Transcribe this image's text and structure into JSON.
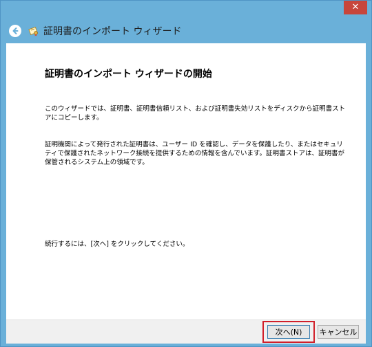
{
  "window": {
    "title": "証明書のインポート ウィザード",
    "close_glyph": "✕"
  },
  "main": {
    "heading": "証明書のインポート ウィザードの開始",
    "paragraph1": "このウィザードでは、証明書、証明書信頼リスト、および証明書失効リストをディスクから証明書ストアにコピーします。",
    "paragraph2": "証明機関によって発行された証明書は、ユーザー ID を確認し、データを保護したり、またはセキュリティで保護されたネットワーク接続を提供するための情報を含んでいます。証明書ストアは、証明書が保管されるシステム上の領域です。",
    "paragraph3": "続行するには、[次へ] をクリックしてください。"
  },
  "footer": {
    "next_label": "次へ(N)",
    "cancel_label": "キャンセル"
  },
  "colors": {
    "titlebar": "#6ab0d9",
    "close": "#c7463c",
    "highlight": "#d11f2a"
  },
  "icons": {
    "back": "back-arrow-icon",
    "certificate": "certificate-icon",
    "close": "close-icon"
  }
}
